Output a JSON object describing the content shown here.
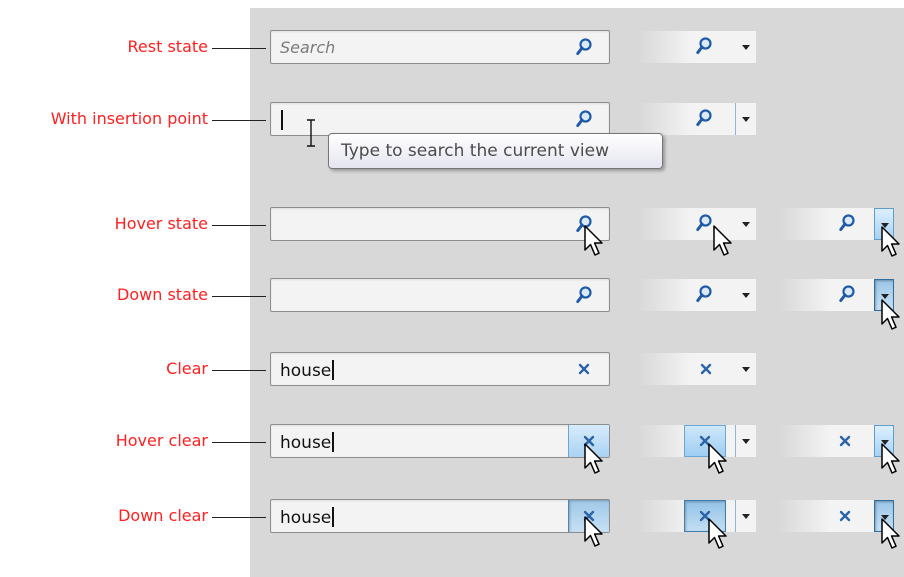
{
  "states": [
    {
      "label": "Rest state",
      "value": "",
      "placeholder": "Search",
      "icon": "magnifier-icon"
    },
    {
      "label": "With insertion point",
      "value": "",
      "icon": "magnifier-icon"
    },
    {
      "label": "Hover state",
      "value": "",
      "icon": "magnifier-icon"
    },
    {
      "label": "Down state",
      "value": "",
      "icon": "magnifier-icon"
    },
    {
      "label": "Clear",
      "value": "house",
      "icon": "clear-icon"
    },
    {
      "label": "Hover clear",
      "value": "house",
      "icon": "clear-icon"
    },
    {
      "label": "Down clear",
      "value": "house",
      "icon": "clear-icon"
    }
  ],
  "tooltip": {
    "text": "Type to search the current view"
  },
  "colors": {
    "label": "#ff2020",
    "panel": "#d8d8d8",
    "field": "#f3f3f3",
    "icon": "#1e5aa8",
    "hot": "#a9d2f3"
  }
}
